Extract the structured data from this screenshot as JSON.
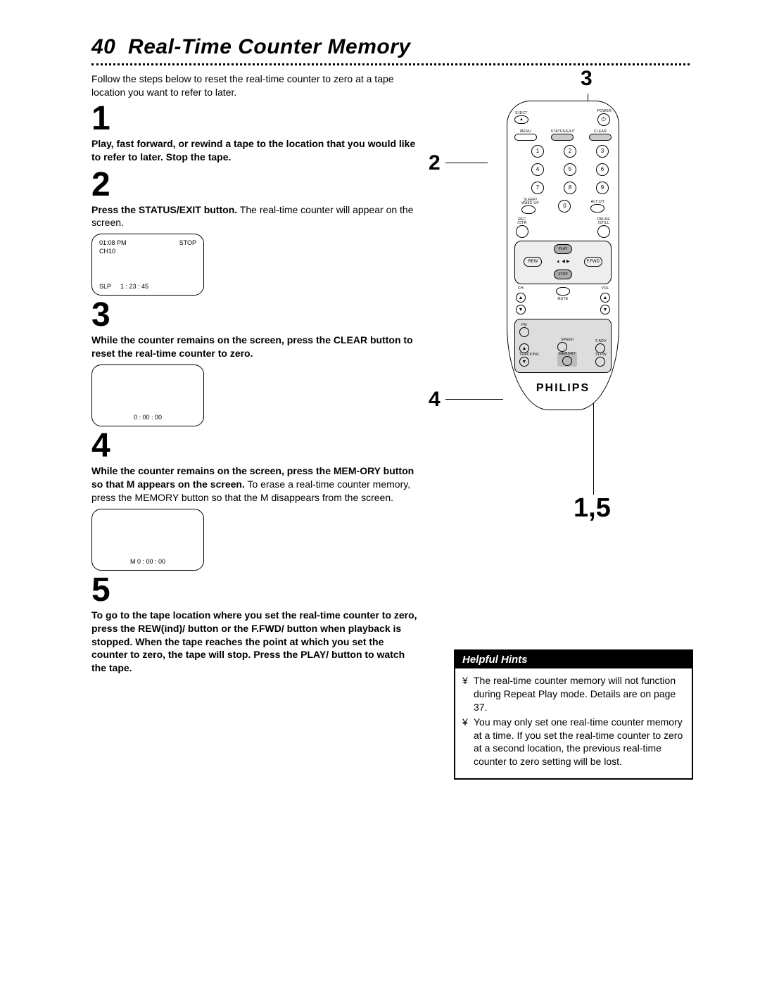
{
  "page_number": "40",
  "title": "Real-Time Counter Memory",
  "intro": "Follow the steps below to reset the real-time counter to zero at a tape location you want to refer to later.",
  "steps": [
    {
      "num": "1",
      "bold": "Play, fast forward, or rewind a tape to the location that you would like to refer to later.  Stop the tape.",
      "rest": ""
    },
    {
      "num": "2",
      "bold": "Press the STATUS/EXIT button.",
      "rest": "  The real-time counter will appear on the screen."
    },
    {
      "num": "3",
      "bold": "While the counter remains on the screen, press the CLEAR button to reset the real-time counter to zero.",
      "rest": ""
    },
    {
      "num": "4",
      "bold": "While the counter remains on the screen, press the MEM-ORY button so that M appears on the screen.",
      "rest": "  To erase a real-time counter memory, press the MEMORY button so that the M disappears from the screen."
    },
    {
      "num": "5",
      "bold": "To go to the tape location where you set the real-time counter to zero, press the REW(ind)/    button or the F.FWD/    button when playback is stopped. When the tape reaches the point at which you set the counter to zero, the tape will stop. Press the PLAY/    button to watch the tape.",
      "rest": ""
    }
  ],
  "screen1": {
    "time": "01:08 PM",
    "status": "STOP",
    "ch": "CH10",
    "speed": "SLP",
    "counter": "1 : 23 : 45"
  },
  "screen2": {
    "counter": "0 : 00 : 00"
  },
  "screen3": {
    "counter": "M  0 : 00 : 00"
  },
  "hints": {
    "title": "Helpful Hints",
    "items": [
      "The real-time counter memory will not function during Repeat Play mode.  Details are on page 37.",
      "You may only set one real-time counter memory at a time. If you set the real-time counter to zero at a second location, the previous real-time counter to zero setting will be lost."
    ],
    "bullet": "¥"
  },
  "remote": {
    "eject": "EJECT",
    "power": "POWER",
    "menu": "MENU",
    "status_exit": "STATUS/EXIT",
    "clear": "CLEAR",
    "num1": "1",
    "num2": "2",
    "num3": "3",
    "num4": "4",
    "num5": "5",
    "num6": "6",
    "num7": "7",
    "num8": "8",
    "num9": "9",
    "num0": "0",
    "sleep": "SLEEP/\nWAKE UP",
    "altch": "ALT.CH",
    "rec": "REC\n/OTR",
    "play": "PLAY",
    "pause": "PAUSE\n/STILL",
    "rew": "REW",
    "ffwd": "F.FWD",
    "stop": "STOP",
    "ch": "CH",
    "vol": "VOL",
    "mute": "MUTE",
    "fm": "FM",
    "speed": "SPEED",
    "fadv": "F.ADV",
    "tracking": "TRACKING",
    "memory": "MEMORY",
    "slow": "SLOW",
    "brand": "PHILIPS"
  },
  "callouts": {
    "c2": "2",
    "c3": "3",
    "c4": "4",
    "c15": "1,5"
  }
}
